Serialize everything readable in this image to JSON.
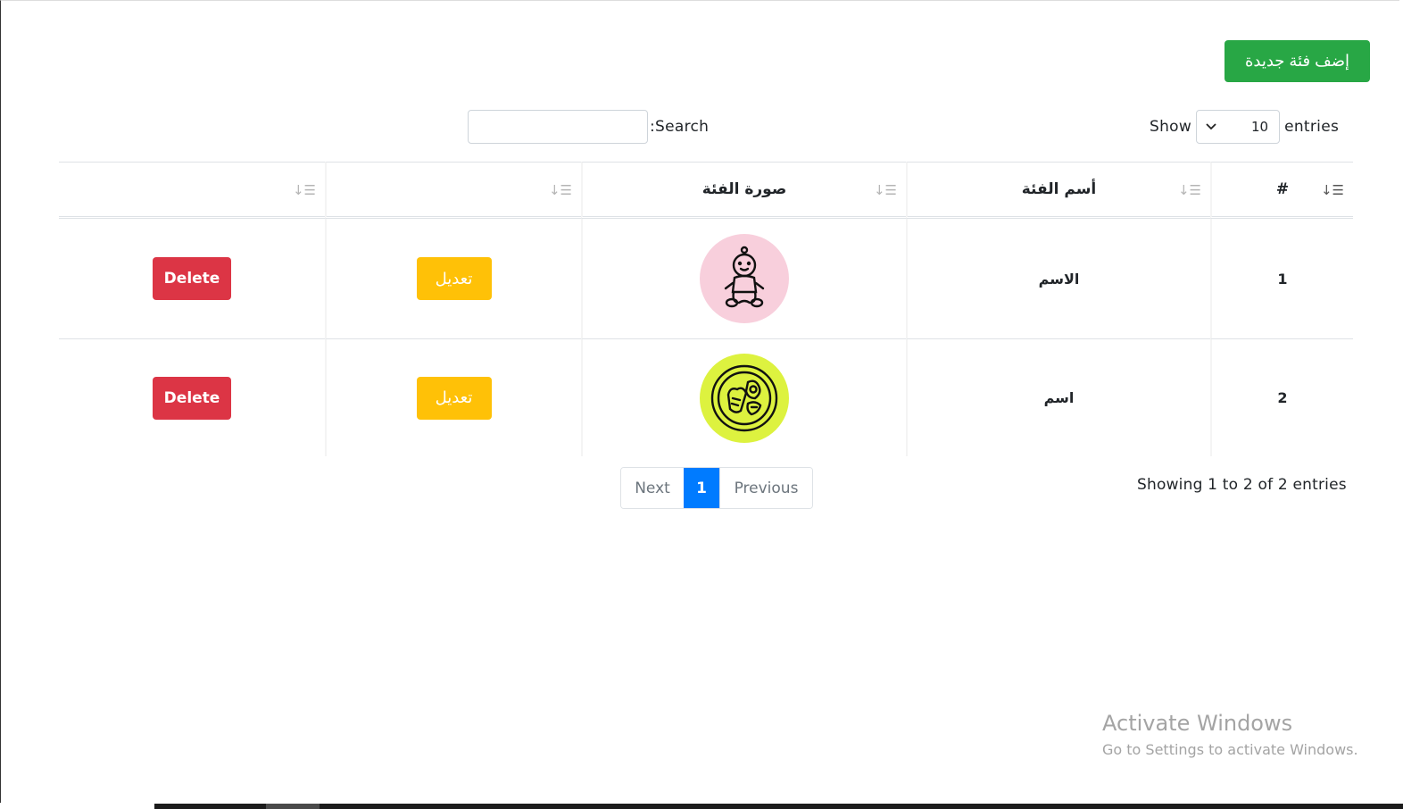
{
  "toolbar": {
    "add_label": "إضف فئة جديدة"
  },
  "length": {
    "show_label": "Show",
    "value": "10",
    "entries_label": "entries"
  },
  "search": {
    "label": ":Search",
    "value": ""
  },
  "table": {
    "headers": [
      "#",
      "أسم الفئة",
      "صورة الفئة",
      "",
      ""
    ],
    "rows": [
      {
        "id": "1",
        "name": "الاسم",
        "image": "baby-icon",
        "edit_label": "تعديل",
        "delete_label": "Delete"
      },
      {
        "id": "2",
        "name": "اسم",
        "image": "food-plate-icon",
        "edit_label": "تعديل",
        "delete_label": "Delete"
      }
    ]
  },
  "footer": {
    "info": "Showing 1 to 2 of 2 entries",
    "pagination": {
      "next": "Next",
      "current": "1",
      "previous": "Previous"
    }
  },
  "watermark": {
    "title": "Activate Windows",
    "subtitle": "Go to Settings to activate Windows."
  },
  "colors": {
    "add": "#28a745",
    "edit": "#ffc107",
    "delete": "#dc3545",
    "page_active": "#007bff",
    "img1_bg": "#f8cfdc",
    "img2_bg": "#ddf23f"
  }
}
